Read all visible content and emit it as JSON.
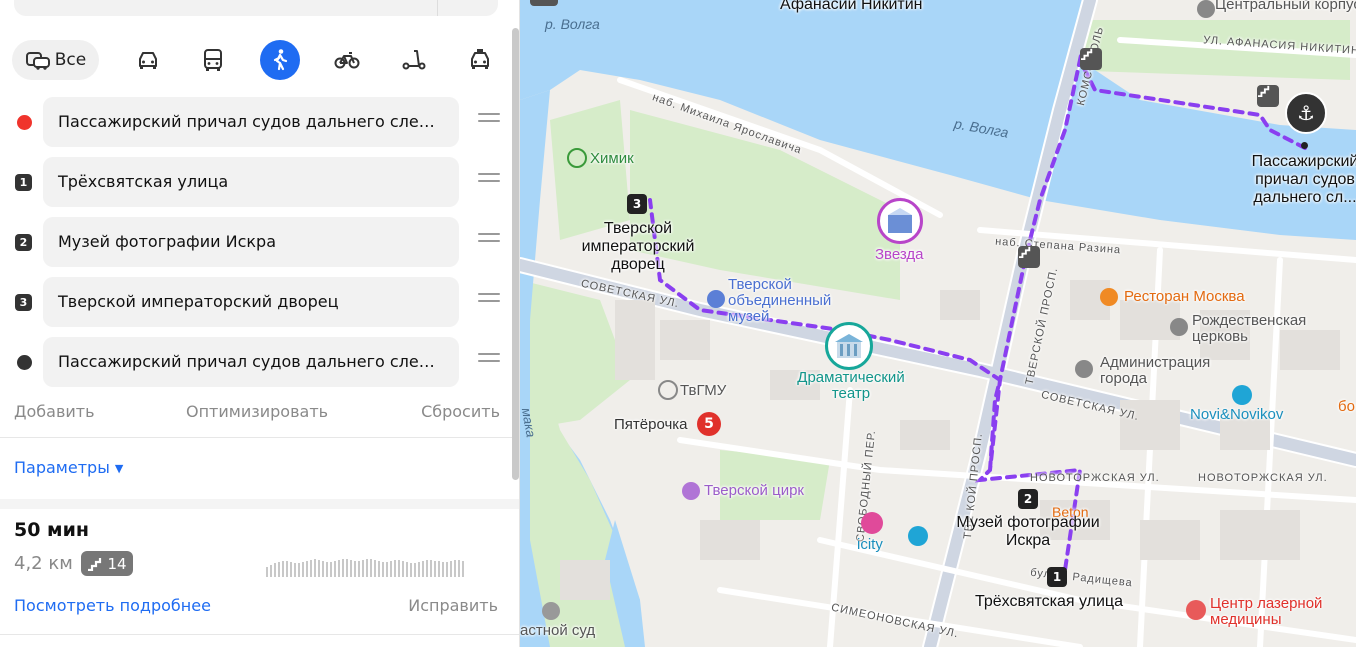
{
  "transport_modes": {
    "all_label": "Все",
    "items": [
      "car-icon",
      "bus-icon",
      "walk-icon",
      "bike-icon",
      "scooter-icon",
      "taxi-icon"
    ],
    "active": "walk-icon",
    "active_color": "#1f6cf2"
  },
  "waypoints": [
    {
      "marker": "",
      "name": "Пассажирский причал судов дальнего следования",
      "marker_color": "#f0342c"
    },
    {
      "marker": "1",
      "name": "Трёхсвятская улица"
    },
    {
      "marker": "2",
      "name": "Музей фотографии Искра"
    },
    {
      "marker": "3",
      "name": "Тверской императорский дворец"
    },
    {
      "marker": "",
      "name": "Пассажирский причал судов дальнего следования",
      "marker_color": "#333333"
    }
  ],
  "actions": {
    "add": "Добавить",
    "optimize": "Оптимизировать",
    "reset": "Сбросить"
  },
  "params_label": "Параметры",
  "route": {
    "time": "50 мин",
    "distance": "4,2 км",
    "stairs_count": "14",
    "details_link": "Посмотреть подробнее",
    "fix_link": "Исправить"
  },
  "map": {
    "labels": {
      "afanasy": "Афанасий Никитин",
      "central_corpus": "Центральный корпус",
      "afanasy_street": "УЛ. АФАНАСИЯ НИКИТИНА",
      "volga_1": "р. Волга",
      "volga_2": "р. Волга",
      "embankment": "наб. Михаила Ярославича",
      "khimik": "Химик",
      "wp3_title": "Тверской императорский дворец",
      "museum_united": "Тверской объединенный музей",
      "zvezda": "Звезда",
      "razin": "наб. Степана Разина",
      "sovetskaya_1": "СОВЕТСКАЯ УЛ.",
      "sovetskaya_2": "СОВЕТСКАЯ УЛ.",
      "drama": "Драматический театр",
      "tvgmu": "ТвГМУ",
      "pyaterochka": "Пятёрочка",
      "circus": "Тверской цирк",
      "restaurant": "Ресторан Москва",
      "church": "Рождественская церковь",
      "admin": "Администрация города",
      "novi": "Novi&Novikov",
      "tverskoy_pr_1": "ТВЕРСКОЙ ПРОСП.",
      "tverskoy_pr_2": "ТВЕ    КОЙ ПРОСП.",
      "komsomolsky": "КОМСОМОЛЬ",
      "novotorzh_1": "НОВОТОРЖСКАЯ УЛ.",
      "novotorzh_2": "НОВОТОРЖСКАЯ УЛ.",
      "svobodny": "СВОБОДНЫЙ ПЕР.",
      "wp2_title": "Музей фотографии Искра",
      "wp1_title": "Трёхсвятская улица",
      "start_title": "Пассажирский причал судов дальнего сл...",
      "icity": "icity",
      "beton": "Beton",
      "laser": "Центр лазерной медицины",
      "boulevard": "бульв. Радищева",
      "simeonovskaya": "СИМЕОНОВСКАЯ УЛ.",
      "court": "астной суд",
      "edge_bo": "бо",
      "edge_maka": "мака"
    },
    "route_color": "#8a3ff0",
    "water_color": "#a9d6f8",
    "park_color": "#d6ecc9"
  }
}
